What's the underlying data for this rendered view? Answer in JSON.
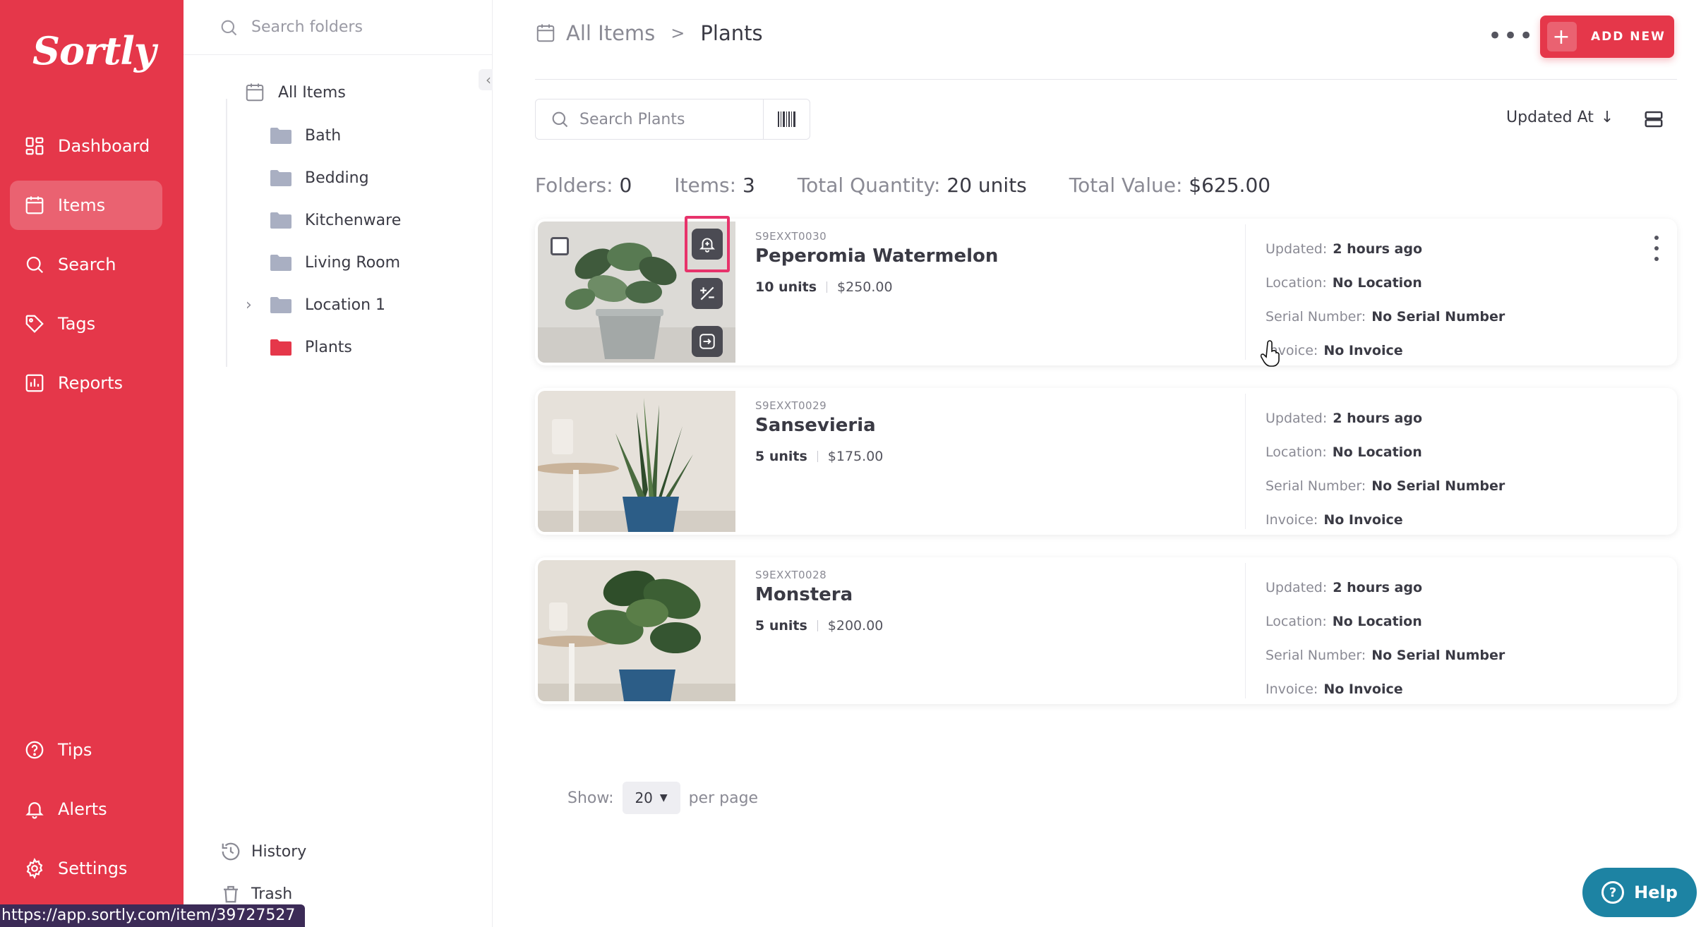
{
  "app": {
    "logo": "Sortly"
  },
  "nav": {
    "items": [
      {
        "label": "Dashboard"
      },
      {
        "label": "Items"
      },
      {
        "label": "Search"
      },
      {
        "label": "Tags"
      },
      {
        "label": "Reports"
      }
    ],
    "bottom_items": [
      {
        "label": "Tips"
      },
      {
        "label": "Alerts"
      },
      {
        "label": "Settings"
      }
    ],
    "active": "Items",
    "accent_color": "#e5374a"
  },
  "folders": {
    "search_placeholder": "Search folders",
    "root": "All Items",
    "children": [
      {
        "label": "Bath"
      },
      {
        "label": "Bedding"
      },
      {
        "label": "Kitchenware"
      },
      {
        "label": "Living Room"
      },
      {
        "label": "Location 1"
      },
      {
        "label": "Plants"
      }
    ],
    "selected": "Plants",
    "footer": {
      "history": "History",
      "trash": "Trash"
    }
  },
  "header": {
    "breadcrumb_root": "All Items",
    "breadcrumb_sep": ">",
    "breadcrumb_current": "Plants",
    "add_new_label": "ADD NEW"
  },
  "toolbar": {
    "search_placeholder": "Search Plants",
    "sort_label": "Updated At"
  },
  "stats": {
    "folders_label": "Folders:",
    "folders_value": "0",
    "items_label": "Items:",
    "items_value": "3",
    "qty_label": "Total Quantity:",
    "qty_value": "20 units",
    "value_label": "Total Value:",
    "value_value": "$625.00"
  },
  "items": [
    {
      "sku": "S9EXXT0030",
      "name": "Peperomia Watermelon",
      "units": "10 units",
      "price": "$250.00",
      "updated_label": "Updated:",
      "updated": "2 hours ago",
      "location_label": "Location:",
      "location": "No Location",
      "serial_label": "Serial Number:",
      "serial": "No Serial Number",
      "invoice_label": "Invoice:",
      "invoice": "No Invoice"
    },
    {
      "sku": "S9EXXT0029",
      "name": "Sansevieria",
      "units": "5 units",
      "price": "$175.00",
      "updated_label": "Updated:",
      "updated": "2 hours ago",
      "location_label": "Location:",
      "location": "No Location",
      "serial_label": "Serial Number:",
      "serial": "No Serial Number",
      "invoice_label": "Invoice:",
      "invoice": "No Invoice"
    },
    {
      "sku": "S9EXXT0028",
      "name": "Monstera",
      "units": "5 units",
      "price": "$200.00",
      "updated_label": "Updated:",
      "updated": "2 hours ago",
      "location_label": "Location:",
      "location": "No Location",
      "serial_label": "Serial Number:",
      "serial": "No Serial Number",
      "invoice_label": "Invoice:",
      "invoice": "No Invoice"
    }
  ],
  "pager": {
    "show_label": "Show:",
    "per_page_value": "20",
    "per_page_label": "per page"
  },
  "help": {
    "label": "Help"
  },
  "status_bar": {
    "url": "https://app.sortly.com/item/39727527"
  }
}
